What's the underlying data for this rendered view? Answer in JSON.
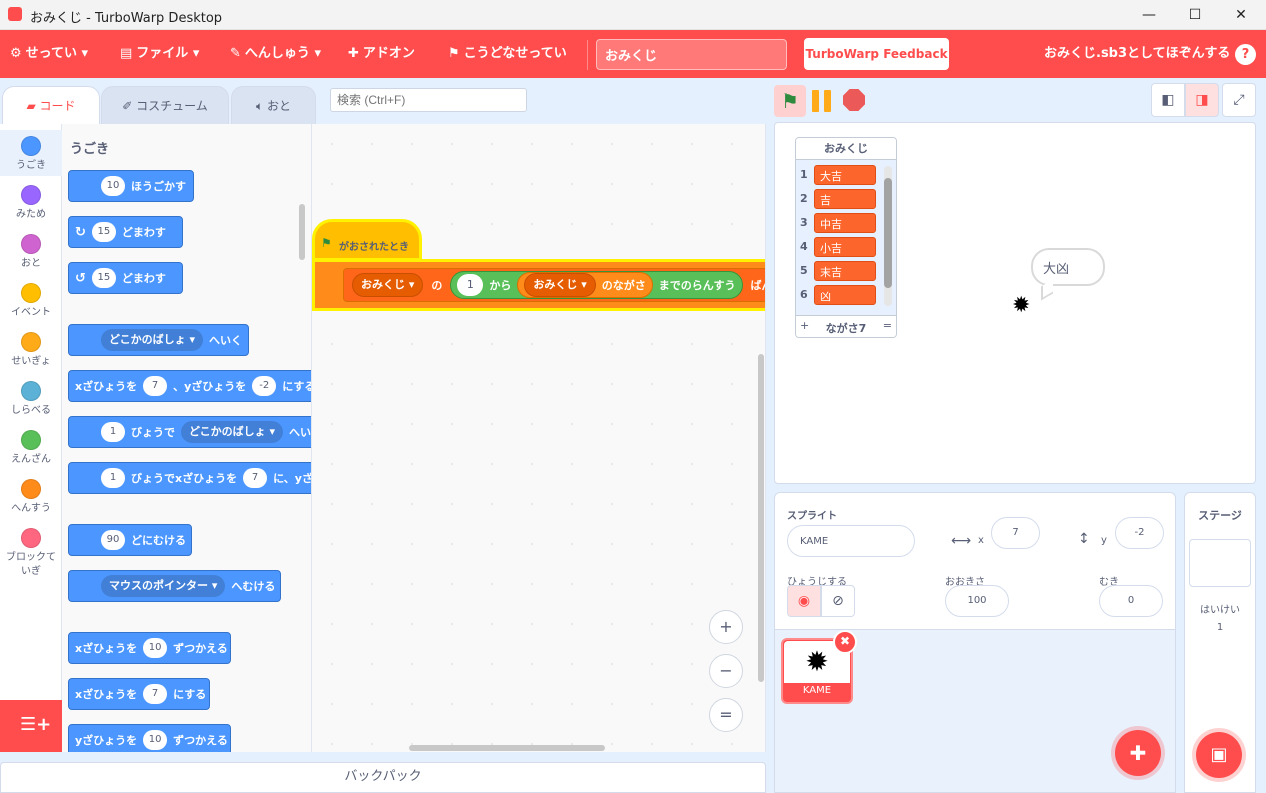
{
  "window": {
    "title": "おみくじ - TurboWarp Desktop",
    "minimize_icon": "—",
    "maximize_icon": "☐",
    "close_icon": "✕"
  },
  "menubar": {
    "settings": "せってい",
    "file": "ファイル",
    "edit": "へんしゅう",
    "addons": "アドオン",
    "howto": "こうどなせってい",
    "project_title": "おみくじ",
    "feedback": "TurboWarp Feedback",
    "save": "おみくじ.sb3としてほぞんする",
    "help": "?"
  },
  "tabs": {
    "code": "コード",
    "costumes": "コスチューム",
    "sounds": "おと"
  },
  "search": {
    "placeholder": "検索 (Ctrl+F)"
  },
  "categories": [
    {
      "label": "うごき",
      "color": "#4c97ff"
    },
    {
      "label": "みため",
      "color": "#9966ff"
    },
    {
      "label": "おと",
      "color": "#cf63cf"
    },
    {
      "label": "イベント",
      "color": "#ffbf00"
    },
    {
      "label": "せいぎょ",
      "color": "#ffab19"
    },
    {
      "label": "しらべる",
      "color": "#5cb1d6"
    },
    {
      "label": "えんざん",
      "color": "#59c059"
    },
    {
      "label": "へんすう",
      "color": "#ff8c1a"
    },
    {
      "label": "ブロックていぎ",
      "color": "#ff6680"
    }
  ],
  "palette": {
    "section_title": "うごき",
    "blocks": {
      "move": {
        "num": "10",
        "text": "ほうごかす"
      },
      "turn_right": {
        "num": "15",
        "text": "どまわす"
      },
      "turn_left": {
        "num": "15",
        "text": "どまわす"
      },
      "goto": {
        "dropdown": "どこかのばしょ",
        "text": "へいく"
      },
      "gotoxy": {
        "t1": "xざひょうを",
        "x": "7",
        "t2": "、yざひょうを",
        "y": "-2",
        "t3": "にする"
      },
      "glide": {
        "num": "1",
        "t1": "びょうで",
        "dropdown": "どこかのばしょ",
        "t2": "へい"
      },
      "glidexy": {
        "num": "1",
        "t1": "びょうでxざひょうを",
        "x": "7",
        "t2": "に、yざ"
      },
      "point": {
        "num": "90",
        "text": "どにむける"
      },
      "pointtowards": {
        "dropdown": "マウスのポインター",
        "text": "へむける"
      },
      "changex": {
        "t1": "xざひょうを",
        "num": "10",
        "t2": "ずつかえる"
      },
      "setx": {
        "t1": "xざひょうを",
        "num": "7",
        "t2": "にする"
      },
      "changey": {
        "t1": "yざひょうを",
        "num": "10",
        "t2": "ずつかえる"
      }
    }
  },
  "script": {
    "hat_label": "がおされたとき",
    "set_var": "おみくじ",
    "of": "の",
    "index": "1",
    "from": "から",
    "list_name": "おみくじ",
    "length_of": "のながさ",
    "random_until": "までのらんすう",
    "item_suffix": "ばんめ"
  },
  "zoom": {
    "in": "+",
    "out": "−",
    "reset": "="
  },
  "backpack": "バックパック",
  "stage": {
    "list_monitor": {
      "title": "おみくじ",
      "items": [
        "大吉",
        "吉",
        "中吉",
        "小吉",
        "末吉",
        "凶"
      ],
      "add": "+",
      "length_label": "ながさ7",
      "resize": "="
    },
    "bubble_text": "大凶"
  },
  "sprite_info": {
    "sprite_label": "スプライト",
    "sprite_name": "KAME",
    "x_label": "x",
    "x_value": "7",
    "y_label": "y",
    "y_value": "-2",
    "show_label": "ひょうじする",
    "size_label": "おおきさ",
    "size_value": "100",
    "direction_label": "むき",
    "direction_value": "0"
  },
  "sprite_list": {
    "sprites": [
      {
        "name": "KAME"
      }
    ]
  },
  "stage_panel": {
    "title": "ステージ",
    "backdrop_label": "はいけい",
    "backdrop_count": "1"
  },
  "colors": {
    "brand": "#ff4c4c",
    "motion": "#4c97ff",
    "variables": "#ff8c1a",
    "list_item": "#fc662c",
    "events": "#ffbf00",
    "operators": "#59c059"
  }
}
